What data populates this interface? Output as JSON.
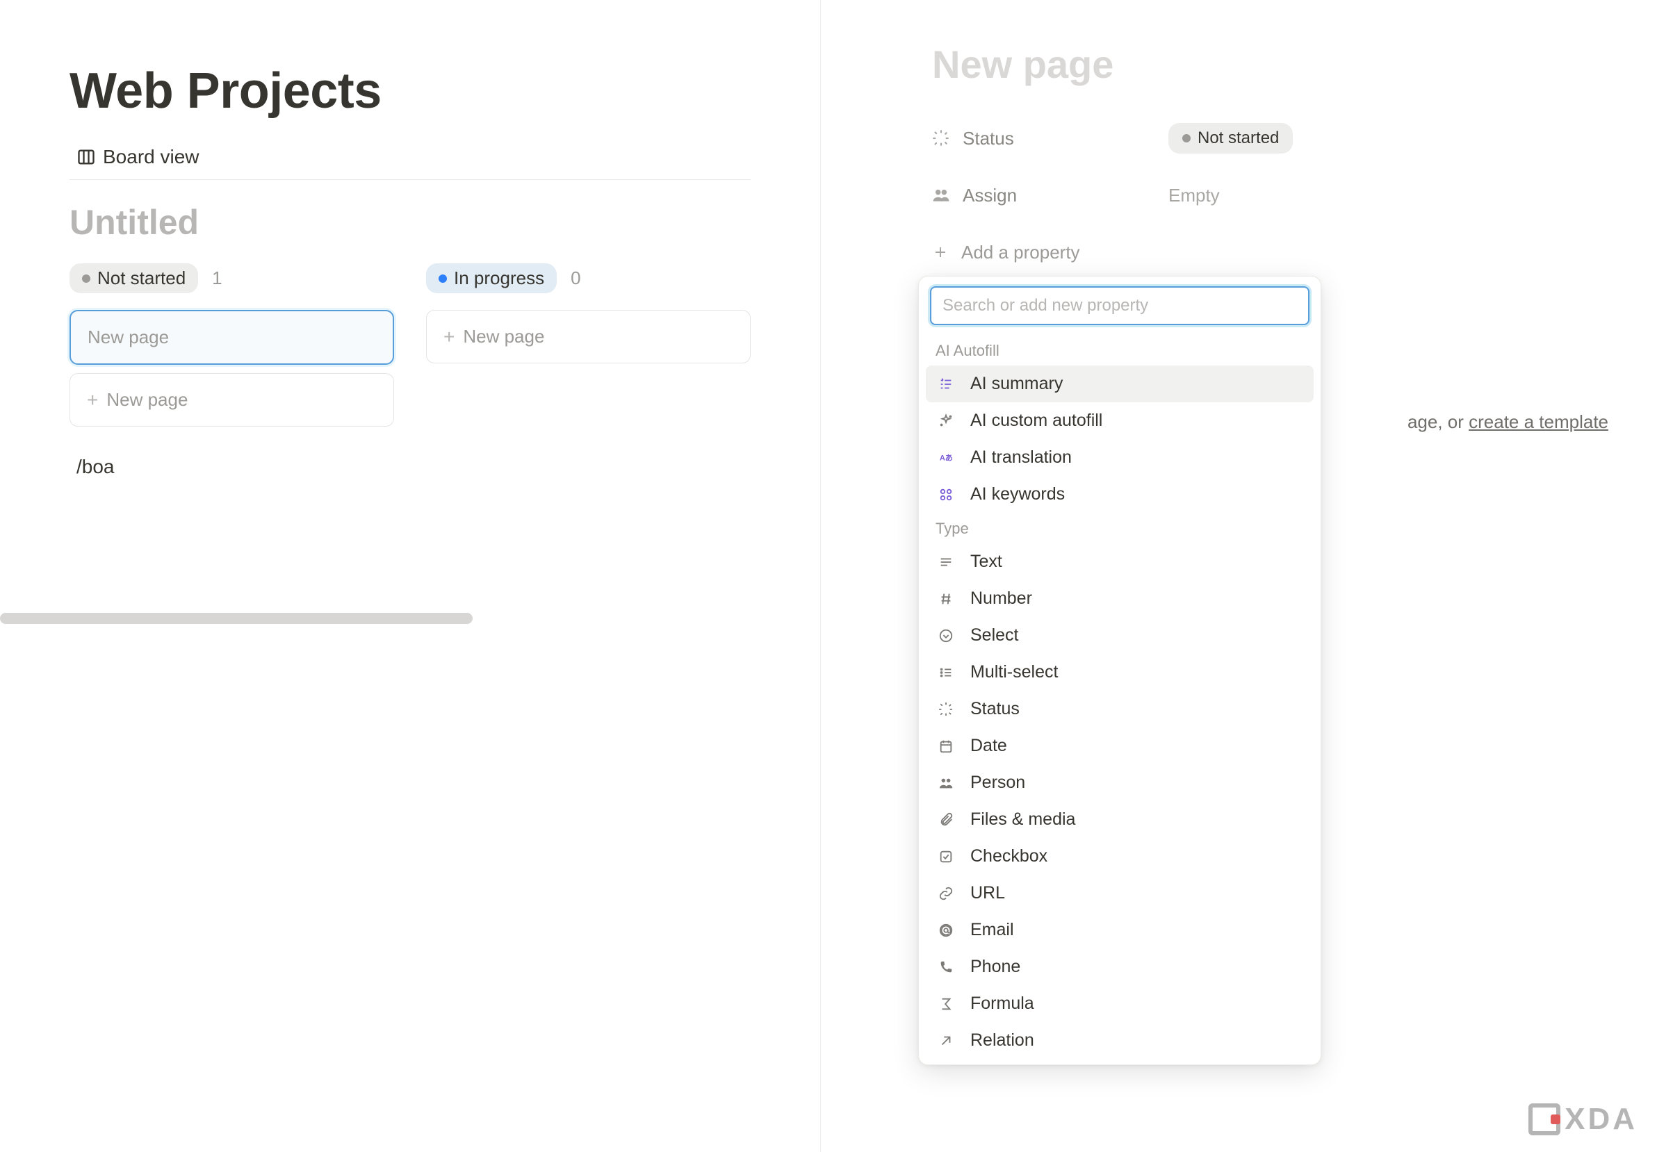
{
  "left": {
    "page_title": "Web Projects",
    "view_tab_label": "Board view",
    "subtitle": "Untitled",
    "columns": [
      {
        "status_label": "Not started",
        "count": "1",
        "style": "gray",
        "cards": [
          {
            "label": "New page",
            "selected": true
          },
          {
            "label": "New page",
            "is_add": true
          }
        ]
      },
      {
        "status_label": "In progress",
        "count": "0",
        "style": "blue",
        "cards": [
          {
            "label": "New page",
            "is_add": true
          }
        ]
      }
    ],
    "slash_text": "/boa"
  },
  "side": {
    "title": "New page",
    "properties": {
      "status": {
        "label": "Status",
        "value": "Not started"
      },
      "assign": {
        "label": "Assign",
        "value": "Empty"
      },
      "add_property": "Add a property"
    },
    "body_hint_suffix": "age, or ",
    "body_hint_link": "create a template"
  },
  "dropdown": {
    "search_placeholder": "Search or add new property",
    "sections": {
      "ai_autofill_label": "AI Autofill",
      "ai_items": [
        {
          "label": "AI summary",
          "icon": "summary",
          "highlight": true
        },
        {
          "label": "AI custom autofill",
          "icon": "sparkle"
        },
        {
          "label": "AI translation",
          "icon": "translate"
        },
        {
          "label": "AI keywords",
          "icon": "keywords"
        }
      ],
      "type_label": "Type",
      "type_items": [
        {
          "label": "Text",
          "icon": "text"
        },
        {
          "label": "Number",
          "icon": "number"
        },
        {
          "label": "Select",
          "icon": "select"
        },
        {
          "label": "Multi-select",
          "icon": "multiselect"
        },
        {
          "label": "Status",
          "icon": "status"
        },
        {
          "label": "Date",
          "icon": "date"
        },
        {
          "label": "Person",
          "icon": "person"
        },
        {
          "label": "Files & media",
          "icon": "files"
        },
        {
          "label": "Checkbox",
          "icon": "checkbox"
        },
        {
          "label": "URL",
          "icon": "url"
        },
        {
          "label": "Email",
          "icon": "email"
        },
        {
          "label": "Phone",
          "icon": "phone"
        },
        {
          "label": "Formula",
          "icon": "formula"
        },
        {
          "label": "Relation",
          "icon": "relation"
        }
      ]
    }
  },
  "watermark": "XDA"
}
